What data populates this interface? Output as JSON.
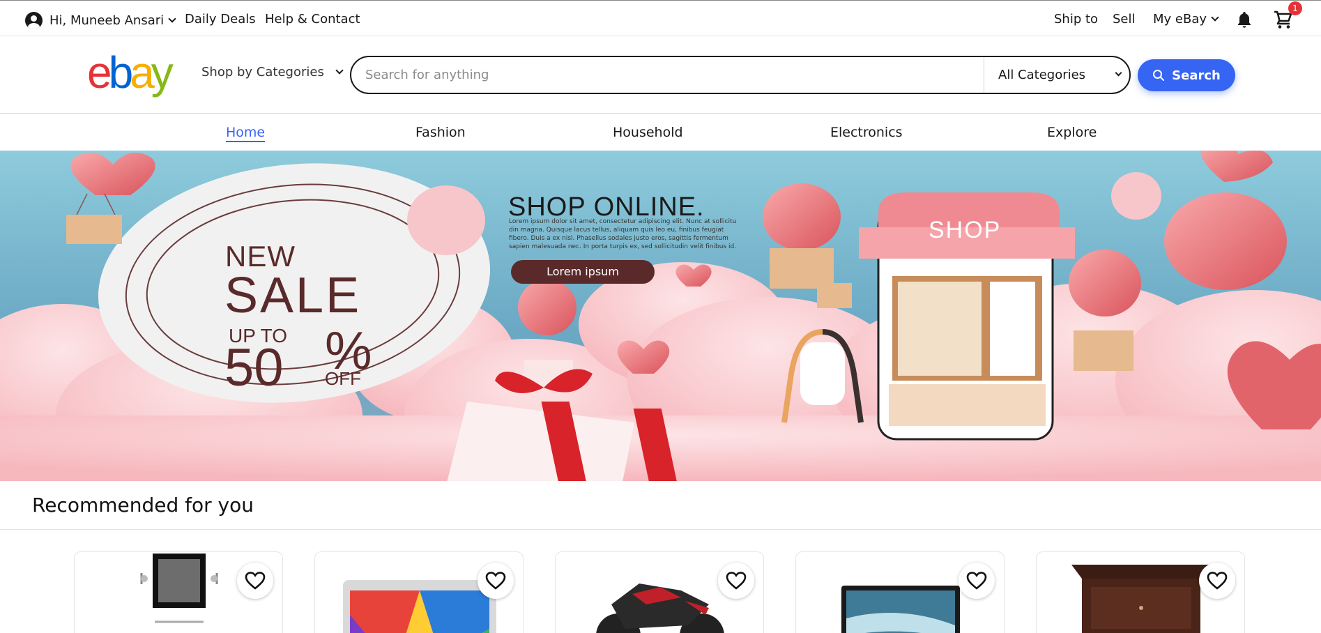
{
  "topbar": {
    "greeting": "Hi, Muneeb Ansari",
    "daily_deals": "Daily Deals",
    "help_contact": "Help & Contact",
    "ship_to": "Ship to",
    "sell": "Sell",
    "my_ebay": "My eBay",
    "cart_count": "1"
  },
  "header": {
    "logo": {
      "e": "e",
      "b": "b",
      "a": "a",
      "y": "y"
    },
    "shop_by_categories": "Shop by Categories",
    "search_placeholder": "Search for anything",
    "category_selected": "All Categories",
    "search_button": "Search"
  },
  "nav": {
    "items": [
      "Home",
      "Fashion",
      "Household",
      "Electronics",
      "Explore"
    ],
    "active": "Home"
  },
  "banner": {
    "new": "NEW",
    "sale": "SALE",
    "up_to": "UP TO",
    "fifty": "50",
    "percent": "%",
    "off": "OFF",
    "shop_online": "SHOP ONLINE.",
    "lorem_lines": [
      "Lorem ipsum dolor sit amet, consectetur adipiscing elit. Nunc at sollicitu",
      "din magna. Quisque lacus tellus, aliquam quis leo eu, finibus feugiat",
      "fibero. Duis a ex nisl. Phasellus sodales justo eros, sagittis fermentum",
      "sapien malesuada nec. In porta turpis ex, sed sollicitudin velit finibus id."
    ],
    "lorem_button": "Lorem ipsum",
    "shop_sign": "SHOP"
  },
  "recommended": {
    "title": "Recommended for you",
    "cards": [
      {
        "name": "mirror-set"
      },
      {
        "name": "tablet"
      },
      {
        "name": "motorcycle"
      },
      {
        "name": "laptop"
      },
      {
        "name": "nightstand"
      }
    ]
  },
  "colors": {
    "accent": "#3665f3",
    "ebay_red": "#e53238",
    "ebay_blue": "#0064d2",
    "ebay_yellow": "#f5af02",
    "ebay_green": "#86b817",
    "sale_text": "#5a2a2a"
  },
  "icons": [
    "user-icon",
    "chevron-down-icon",
    "bell-icon",
    "cart-icon",
    "search-icon",
    "heart-icon"
  ]
}
